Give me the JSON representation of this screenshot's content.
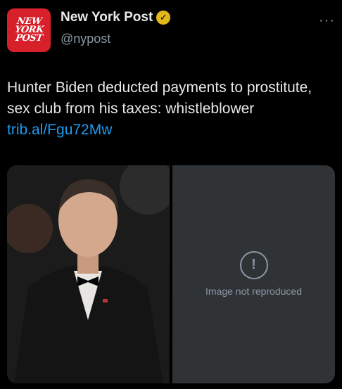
{
  "account": {
    "avatar_text": [
      "NEW",
      "YORK",
      "POST"
    ],
    "name": "New York Post",
    "handle": "@nypost",
    "verified_icon": "checkmark-badge-icon",
    "more_icon": "more-options-icon",
    "more_glyph": "···"
  },
  "tweet": {
    "text": "Hunter Biden deducted payments to prostitute, sex club from his taxes: whistleblower",
    "link_text": "trib.al/Fgu72Mw"
  },
  "media": {
    "right_panel_notice": "Image not reproduced"
  },
  "colors": {
    "background": "#000000",
    "avatar_red": "#d8202a",
    "verified_gold": "#e2b719",
    "link_blue": "#1d9bf0"
  }
}
